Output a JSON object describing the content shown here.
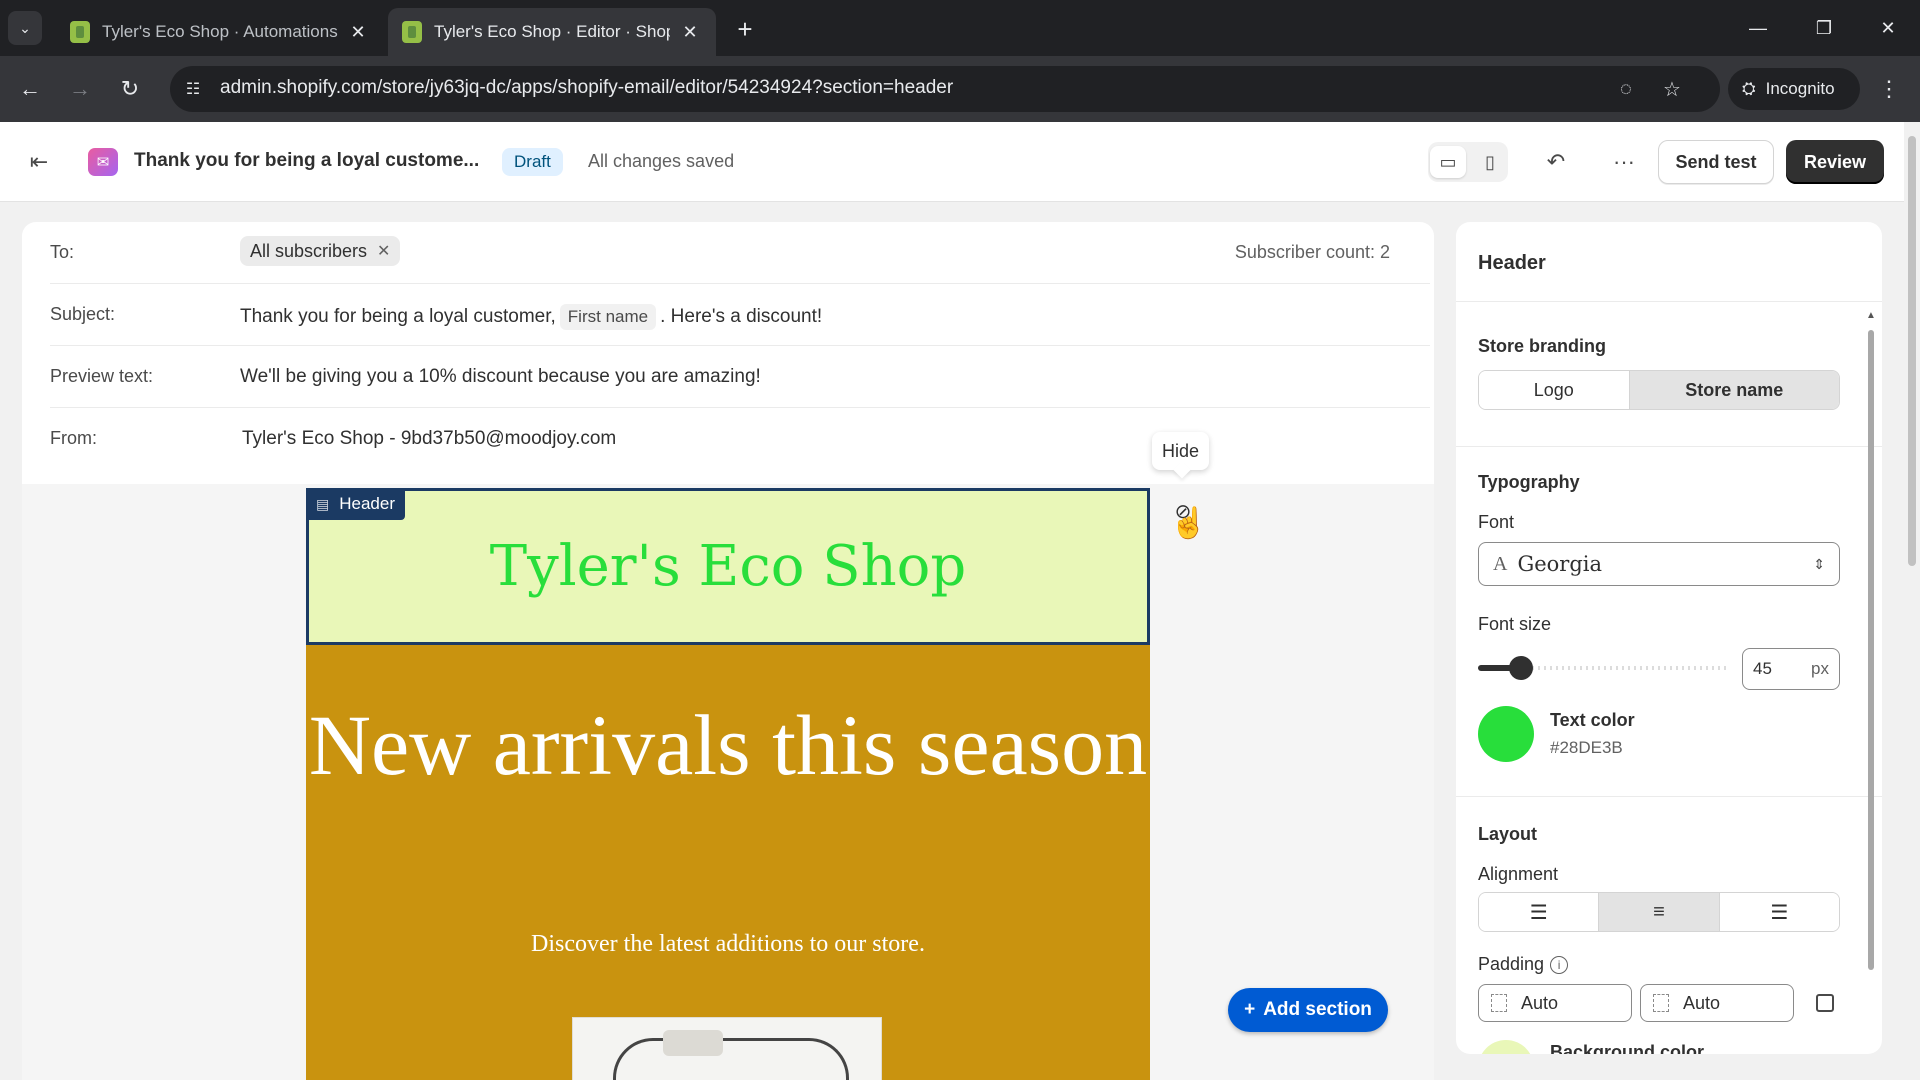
{
  "browser": {
    "tabs": [
      {
        "title": "Tyler's Eco Shop · Automations",
        "active": false
      },
      {
        "title": "Tyler's Eco Shop · Editor · Shopify",
        "active": true
      }
    ],
    "url": "admin.shopify.com/store/jy63jq-dc/apps/shopify-email/editor/54234924?section=header",
    "incognito_label": "Incognito"
  },
  "appbar": {
    "title": "Thank you for being a loyal custome...",
    "status_badge": "Draft",
    "save_state": "All changes saved",
    "send_test_label": "Send test",
    "review_label": "Review"
  },
  "meta": {
    "to_label": "To:",
    "to_chip": "All subscribers",
    "subscriber_count": "Subscriber count: 2",
    "subject_label": "Subject:",
    "subject_before": "Thank you for being a loyal customer,",
    "subject_merge": "First name",
    "subject_after": ". Here's a discount!",
    "preview_label": "Preview text:",
    "preview_value": "We'll be giving you a 10% discount because you are amazing!",
    "from_label": "From:",
    "from_value": "Tyler's Eco Shop - 9bd37b50@moodjoy.com"
  },
  "canvas": {
    "header_tag": "Header",
    "store_name": "Tyler's Eco Shop",
    "hero_title": "New arrivals this season",
    "hero_subtitle": "Discover the latest additions to our store.",
    "hide_tooltip": "Hide",
    "add_section_label": "Add section",
    "colors": {
      "header_bg": "#E9F7B8",
      "hero_bg": "#C9930F",
      "selection": "#1B3A63"
    }
  },
  "panel": {
    "title": "Header",
    "branding": {
      "title": "Store branding",
      "options": [
        "Logo",
        "Store name"
      ],
      "selected": "Store name"
    },
    "typography": {
      "title": "Typography",
      "font_label": "Font",
      "font_value": "Georgia",
      "font_size_label": "Font size",
      "font_size_value": "45",
      "font_size_unit": "px",
      "font_size_slider_fraction": 0.17,
      "text_color_label": "Text color",
      "text_color_hex": "#28DE3B",
      "text_color": "#28DE3B"
    },
    "layout": {
      "title": "Layout",
      "alignment_label": "Alignment",
      "alignment_options": [
        "left-align-icon",
        "center-align-icon",
        "right-align-icon"
      ],
      "alignment_selected": "center",
      "padding_label": "Padding",
      "padding_values": [
        "Auto",
        "Auto"
      ],
      "background_color_label": "Background color",
      "background_color": "#E9F7B8"
    }
  }
}
